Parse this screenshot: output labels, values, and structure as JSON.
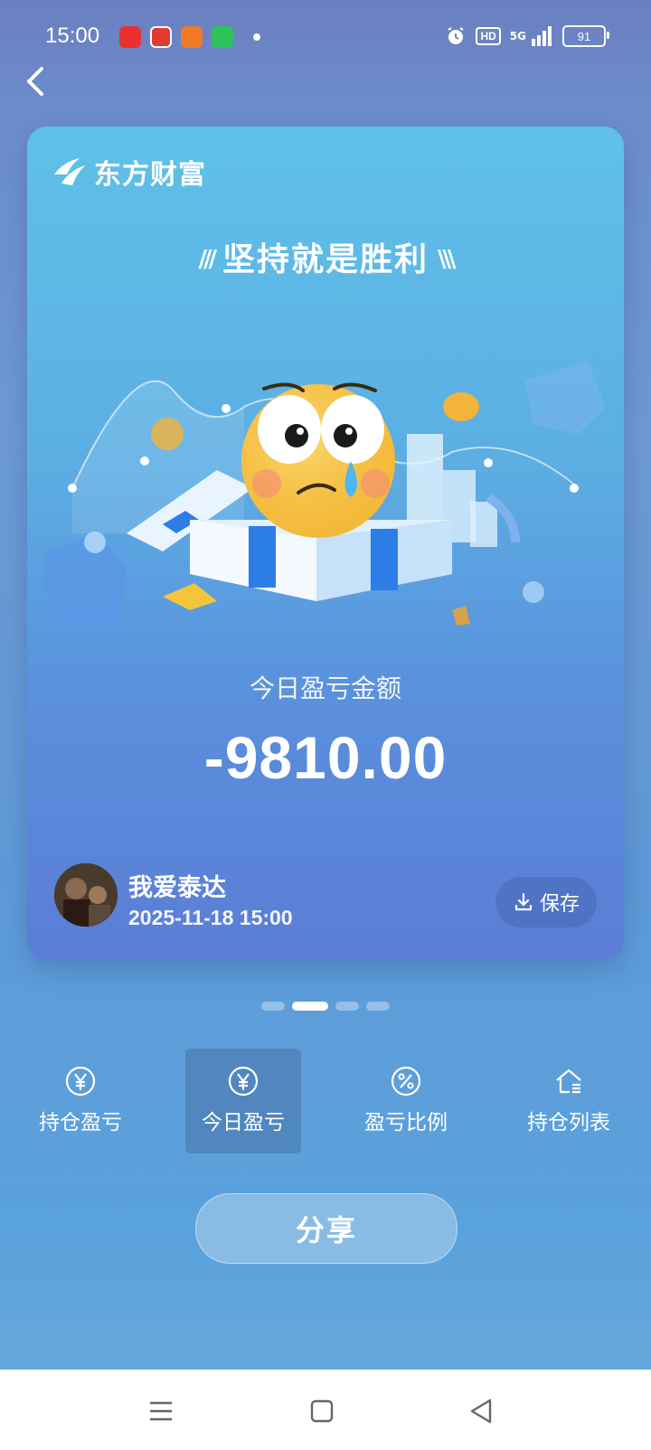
{
  "status_bar": {
    "time": "15:00",
    "hd": "HD",
    "network": "5G",
    "battery": "91"
  },
  "card": {
    "brand": "东方财富",
    "slogan": "坚持就是胜利",
    "pnl_label": "今日盈亏金额",
    "pnl_value": "-9810.00",
    "user_name": "我爱泰达",
    "timestamp": "2025-11-18 15:00",
    "save_label": "保存"
  },
  "pagination": {
    "total": 4,
    "active": 2
  },
  "tabs": [
    {
      "label": "持仓盈亏",
      "icon": "yen-circle-icon"
    },
    {
      "label": "今日盈亏",
      "icon": "yen-circle-icon",
      "active": true
    },
    {
      "label": "盈亏比例",
      "icon": "percent-circle-icon"
    },
    {
      "label": "持仓列表",
      "icon": "home-list-icon"
    }
  ],
  "share_label": "分享",
  "colors": {
    "card_top": "#5fc1e8",
    "card_bottom": "#5b7dd6",
    "emoji_yellow": "#f4c43a"
  }
}
